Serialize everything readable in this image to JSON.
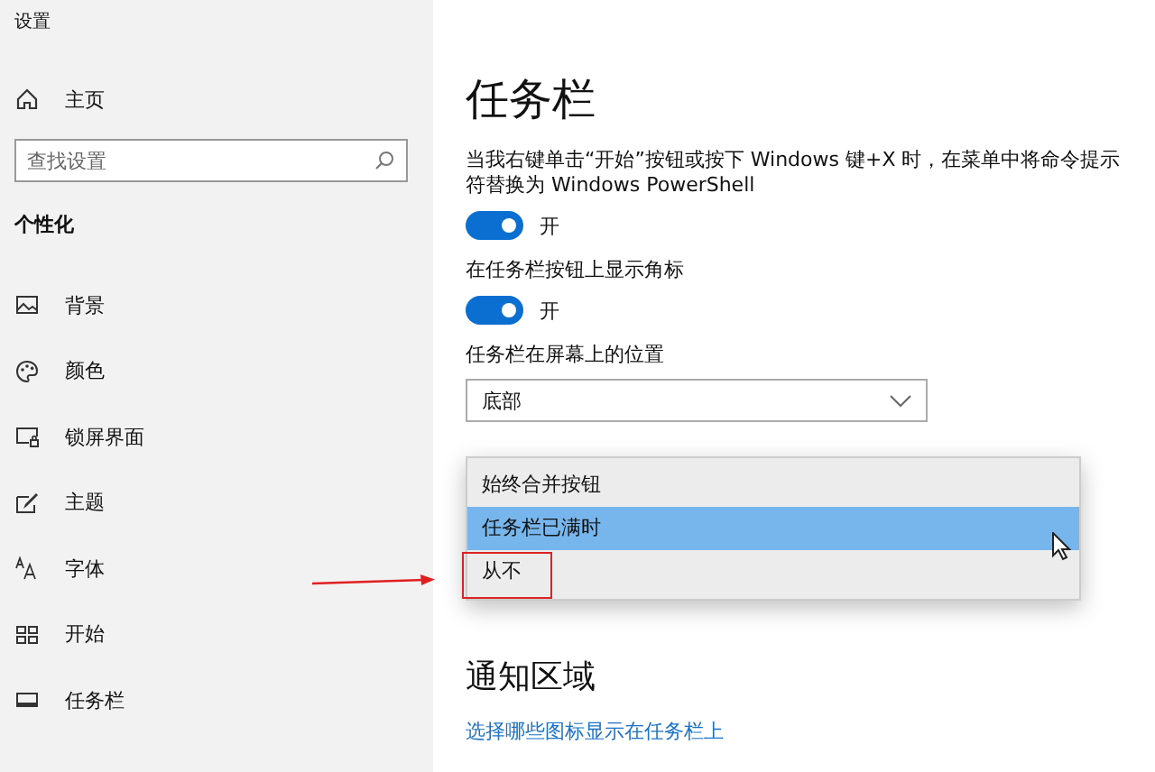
{
  "window": {
    "title": "设置"
  },
  "sidebar": {
    "home": "主页",
    "search": {
      "placeholder": "查找设置"
    },
    "section": "个性化",
    "items": [
      {
        "label": "背景",
        "kind": "picture",
        "selected": false
      },
      {
        "label": "颜色",
        "kind": "palette",
        "selected": false
      },
      {
        "label": "锁屏界面",
        "kind": "lock",
        "selected": false
      },
      {
        "label": "主题",
        "kind": "theme",
        "selected": false
      },
      {
        "label": "字体",
        "kind": "font",
        "selected": false
      },
      {
        "label": "开始",
        "kind": "start",
        "selected": false
      },
      {
        "label": "任务栏",
        "kind": "taskbar",
        "selected": false
      }
    ]
  },
  "main": {
    "title": "任务栏",
    "settings": [
      {
        "kind": "toggle",
        "label": "当我右键单击“开始”按钮或按下 Windows 键+X 时，在菜单中将命令提示符替换为 Windows PowerShell",
        "on": true,
        "state_text": "开"
      },
      {
        "kind": "toggle",
        "label": "在任务栏按钮上显示角标",
        "on": true,
        "state_text": "开"
      },
      {
        "kind": "dropdown",
        "label": "任务栏在屏幕上的位置",
        "value": "底部"
      }
    ],
    "open_list": {
      "options": [
        {
          "label": "始终合并按钮",
          "selected": false
        },
        {
          "label": "任务栏已满时",
          "selected": true
        },
        {
          "label": "从不",
          "selected": false
        }
      ]
    },
    "section": "通知区域",
    "link": "选择哪些图标显示在任务栏上"
  }
}
